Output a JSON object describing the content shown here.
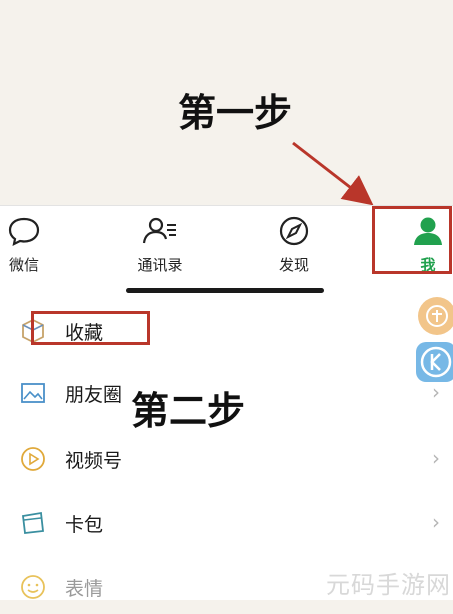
{
  "annotations": {
    "step1": "第一步",
    "step2": "第二步"
  },
  "tabs": [
    {
      "label": "微信",
      "icon": "chat-bubble-icon"
    },
    {
      "label": "通讯录",
      "icon": "contacts-icon"
    },
    {
      "label": "发现",
      "icon": "compass-icon"
    },
    {
      "label": "我",
      "icon": "person-icon",
      "active": true
    }
  ],
  "menu": {
    "items": [
      {
        "label": "收藏",
        "icon": "cube-icon"
      },
      {
        "label": "朋友圈",
        "icon": "image-icon"
      },
      {
        "label": "视频号",
        "icon": "play-icon"
      },
      {
        "label": "卡包",
        "icon": "card-icon"
      },
      {
        "label": "表情",
        "icon": "smile-icon"
      }
    ],
    "chevron": "›"
  },
  "watermark": "元码手游网",
  "colors": {
    "accent_green": "#21a14e",
    "highlight_red": "#b9362a",
    "background": "#f5f2ec"
  }
}
